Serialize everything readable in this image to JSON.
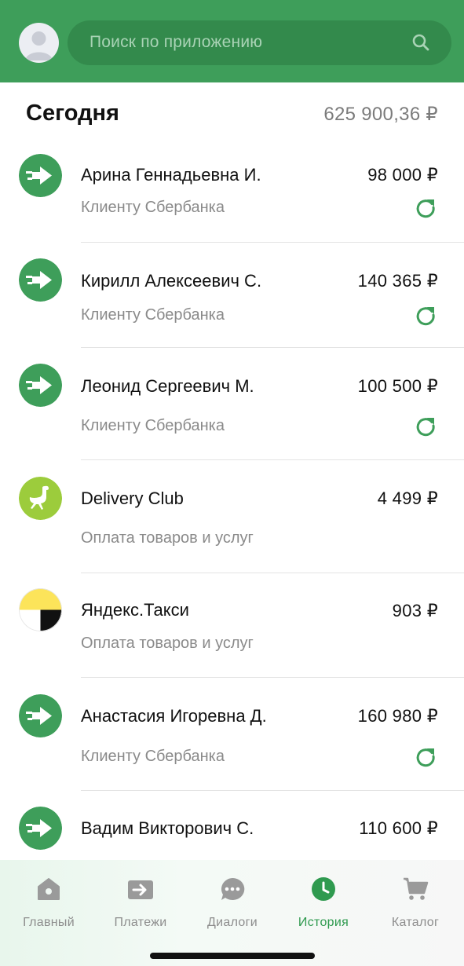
{
  "header": {
    "search_placeholder": "Поиск по приложению",
    "search_icon": "search-icon",
    "avatar_icon": "user-avatar-icon"
  },
  "section": {
    "title": "Сегодня",
    "total": "625 900,36 ₽"
  },
  "transactions": [
    {
      "name": "Арина Геннадьевна И.",
      "subtitle": "Клиенту Сбербанка",
      "amount": "98 000 ₽",
      "icon": "transfer-arrow-icon",
      "repeat": true
    },
    {
      "name": "Кирилл Алексеевич С.",
      "subtitle": "Клиенту Сбербанка",
      "amount": "140 365 ₽",
      "icon": "transfer-arrow-icon",
      "repeat": true
    },
    {
      "name": "Леонид Сергеевич М.",
      "subtitle": "Клиенту Сбербанка",
      "amount": "100 500 ₽",
      "icon": "transfer-arrow-icon",
      "repeat": true
    },
    {
      "name": "Delivery Club",
      "subtitle": "Оплата товаров и услуг",
      "amount": "4 499 ₽",
      "icon": "delivery-club-logo-icon",
      "repeat": false
    },
    {
      "name": "Яндекс.Такси",
      "subtitle": "Оплата товаров и услуг",
      "amount": "903 ₽",
      "icon": "yandex-taxi-logo-icon",
      "repeat": false
    },
    {
      "name": "Анастасия Игоревна Д.",
      "subtitle": "Клиенту Сбербанка",
      "amount": "160 980 ₽",
      "icon": "transfer-arrow-icon",
      "repeat": true
    },
    {
      "name": "Вадим Викторович С.",
      "subtitle": "",
      "amount": "110 600 ₽",
      "icon": "transfer-arrow-icon",
      "repeat": false
    }
  ],
  "nav": {
    "items": [
      {
        "label": "Главный",
        "icon": "home-icon",
        "active": false
      },
      {
        "label": "Платежи",
        "icon": "payments-icon",
        "active": false
      },
      {
        "label": "Диалоги",
        "icon": "dialogs-icon",
        "active": false
      },
      {
        "label": "История",
        "icon": "history-clock-icon",
        "active": true
      },
      {
        "label": "Каталог",
        "icon": "cart-icon",
        "active": false
      }
    ]
  },
  "colors": {
    "brand_green": "#3e9e5a",
    "search_bg": "#338a4c",
    "active_nav": "#2f9a4f"
  }
}
